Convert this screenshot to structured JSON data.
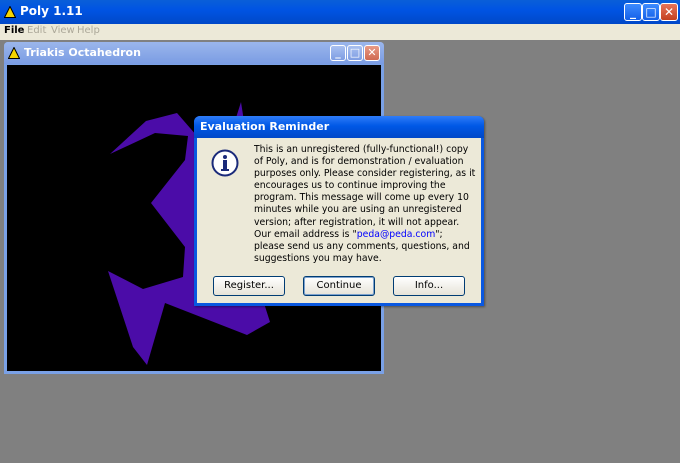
{
  "app": {
    "title": "Poly 1.11",
    "icon": "warning-triangle-icon",
    "controls": {
      "minimize": "_",
      "maximize": "□",
      "close": "✕"
    }
  },
  "menu": {
    "items": [
      {
        "label": "File",
        "enabled": true
      },
      {
        "label": "Edit",
        "enabled": false
      },
      {
        "label": "View",
        "enabled": false
      },
      {
        "label": "Help",
        "enabled": false
      }
    ]
  },
  "child_window": {
    "title": "Triakis Octahedron",
    "icon": "warning-triangle-icon",
    "controls": {
      "minimize": "_",
      "maximize": "□",
      "close": "✕"
    },
    "canvas_color": "#000000",
    "shape_color": "#4b0ca8"
  },
  "dialog": {
    "title": "Evaluation Reminder",
    "icon": "info-icon",
    "message_part1": "This is an unregistered (fully-functional!) copy of Poly, and is for demonstration / evaluation purposes only. Please consider registering, as it encourages us to continue improving the program. This message will come up every 10 minutes while you are using an unregistered version; after registration, it will not appear. Our email address is \"",
    "email": "peda@peda.com",
    "message_part2": "\"; please send us any comments, questions, and suggestions you may have.",
    "buttons": {
      "register": "Register...",
      "continue": "Continue",
      "info": "Info..."
    }
  }
}
